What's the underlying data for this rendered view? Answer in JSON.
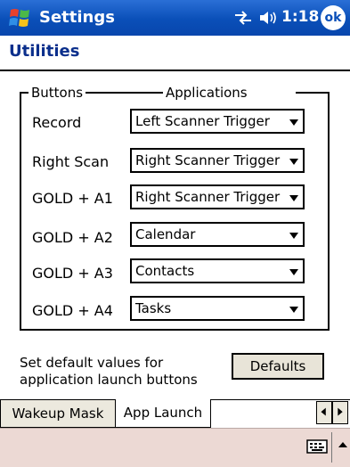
{
  "titlebar": {
    "title": "Settings",
    "time": "1:18",
    "ok_label": "ok"
  },
  "page": {
    "title": "Utilities"
  },
  "columns": {
    "buttons": "Buttons",
    "applications": "Applications"
  },
  "rows": [
    {
      "label": "Record",
      "value": "Left Scanner Trigger"
    },
    {
      "label": "Right Scan",
      "value": "Right Scanner Trigger"
    },
    {
      "label": "GOLD + A1",
      "value": "Right Scanner Trigger"
    },
    {
      "label": "GOLD + A2",
      "value": "Calendar"
    },
    {
      "label": "GOLD + A3",
      "value": "Contacts"
    },
    {
      "label": "GOLD + A4",
      "value": "Tasks"
    }
  ],
  "hint": "Set default values for application launch buttons",
  "defaults_label": "Defaults",
  "tabs": [
    {
      "label": "Wakeup Mask",
      "active": false
    },
    {
      "label": "App Launch",
      "active": true
    }
  ],
  "colors": {
    "titlebar": "#0a4fb8",
    "page_title": "#0b2f8c",
    "menubar": "#ecd9d4"
  },
  "icons": [
    "windows-start-icon",
    "connectivity-icon",
    "volume-icon",
    "keyboard-icon",
    "chevron-up-icon"
  ]
}
